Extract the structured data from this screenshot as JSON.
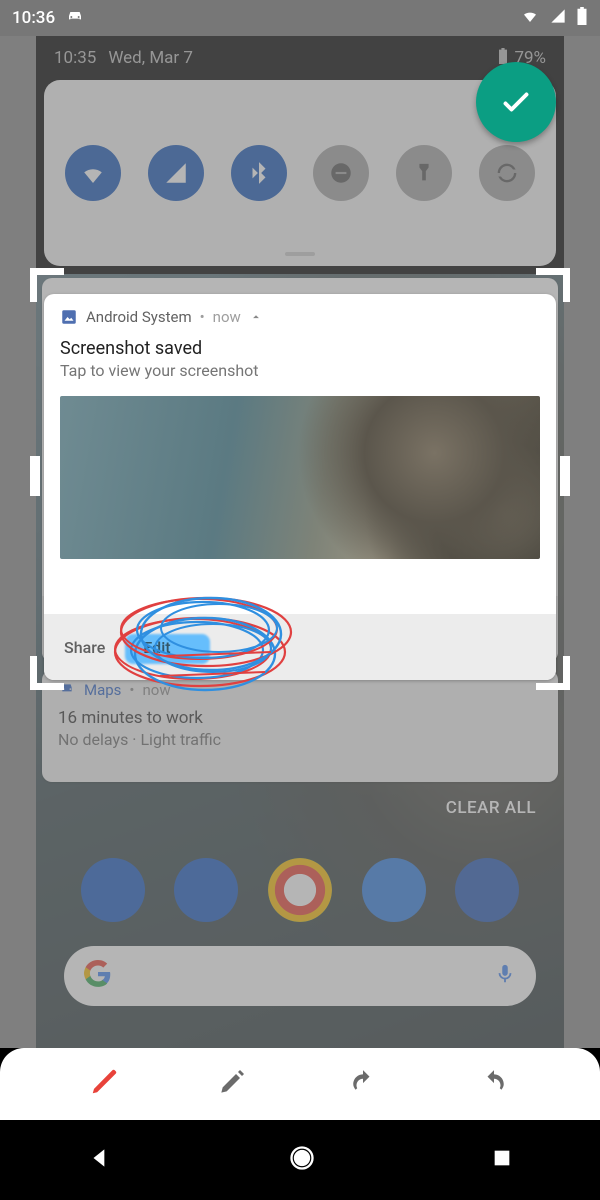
{
  "statusbar": {
    "time": "10:36"
  },
  "shade": {
    "time": "10:35",
    "date": "Wed, Mar 7",
    "battery": "79%"
  },
  "qs": {
    "tiles": [
      {
        "name": "wifi",
        "on": true
      },
      {
        "name": "cell",
        "on": true
      },
      {
        "name": "bluetooth",
        "on": true
      },
      {
        "name": "dnd",
        "on": false
      },
      {
        "name": "flashlight",
        "on": false
      },
      {
        "name": "rotate",
        "on": false
      }
    ]
  },
  "notif1": {
    "app": "Android System",
    "meta_sep": "•",
    "meta_time": "now",
    "title": "Screenshot saved",
    "subtitle": "Tap to view your screenshot",
    "action_share": "Share",
    "action_edit": "Edit"
  },
  "notif2": {
    "app": "Maps",
    "meta_sep": "•",
    "meta_time": "now",
    "line1": "16 minutes to work",
    "line2": "No delays · Light traffic"
  },
  "clear_all": "CLEAR ALL",
  "toolbar": {
    "pen": "pen",
    "marker": "marker",
    "undo": "undo",
    "redo": "redo"
  }
}
